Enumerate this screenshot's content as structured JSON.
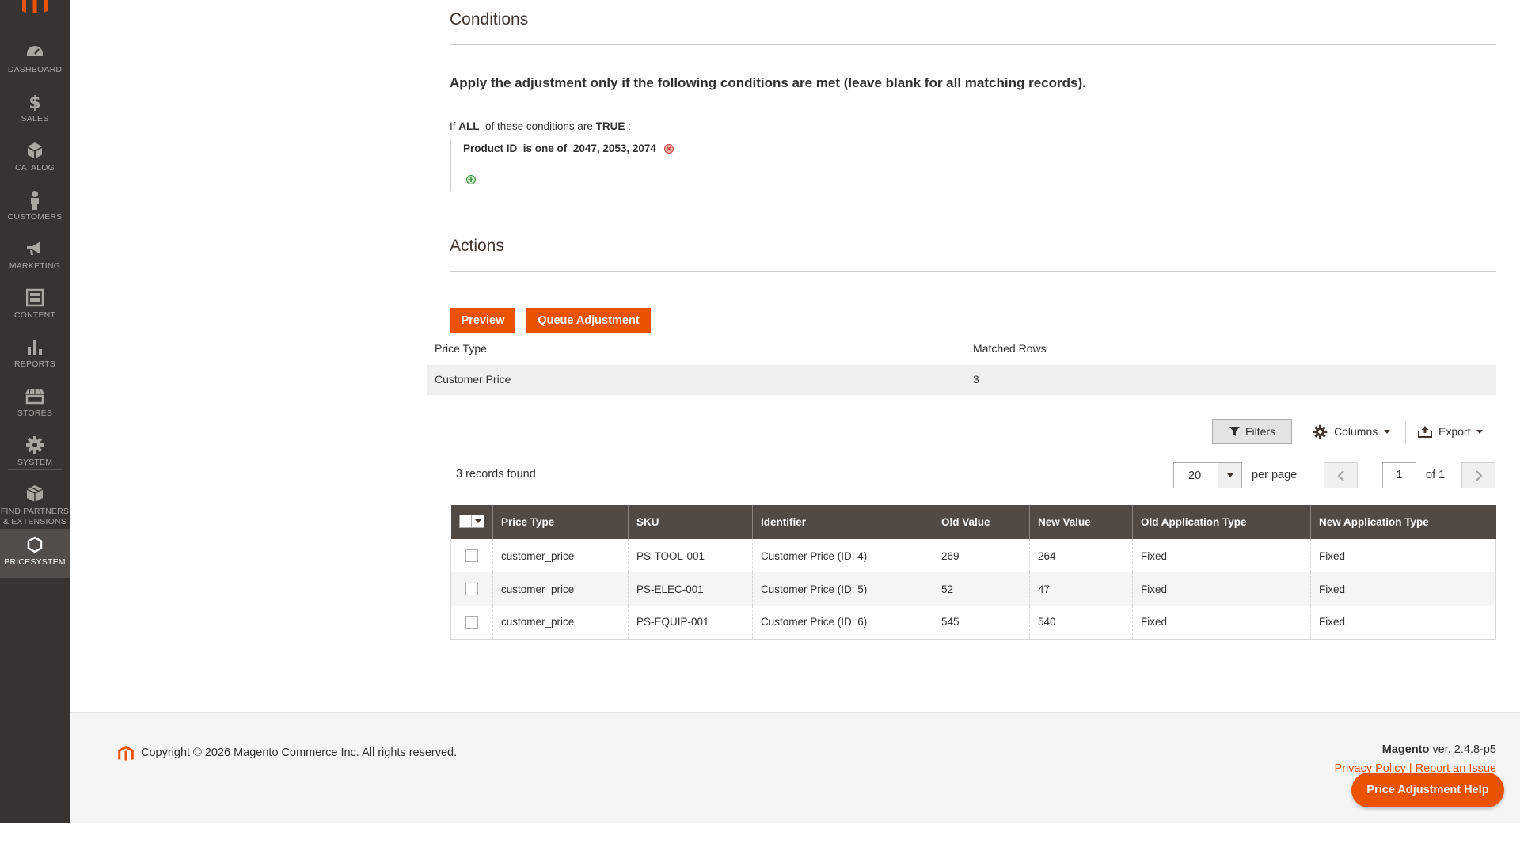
{
  "sidebar": {
    "items": [
      {
        "label": "DASHBOARD",
        "icon": "dashboard-icon"
      },
      {
        "label": "SALES",
        "icon": "dollar-icon"
      },
      {
        "label": "CATALOG",
        "icon": "cube-icon"
      },
      {
        "label": "CUSTOMERS",
        "icon": "person-icon"
      },
      {
        "label": "MARKETING",
        "icon": "megaphone-icon"
      },
      {
        "label": "CONTENT",
        "icon": "layout-icon"
      },
      {
        "label": "REPORTS",
        "icon": "bar-chart-icon"
      },
      {
        "label": "STORES",
        "icon": "storefront-icon"
      },
      {
        "label": "SYSTEM",
        "icon": "gear-icon"
      },
      {
        "label": "FIND PARTNERS & EXTENSIONS",
        "icon": "boxes-icon"
      },
      {
        "label": "PRICESYSTEM",
        "icon": "hexagon-icon"
      }
    ],
    "active": "PRICESYSTEM"
  },
  "conditions": {
    "title": "Conditions",
    "heading": "Apply the adjustment only if the following conditions are met (leave blank for all matching records).",
    "prefix": "If",
    "aggregator": "ALL",
    "middle": "of these conditions are",
    "value": "TRUE",
    "suffix": ":",
    "rule": {
      "attribute": "Product ID",
      "operator": "is one of",
      "value": "2047, 2053, 2074"
    }
  },
  "actions": {
    "title": "Actions",
    "preview_label": "Preview",
    "queue_label": "Queue Adjustment"
  },
  "summary": {
    "headers": [
      "Price Type",
      "Matched Rows"
    ],
    "rows": [
      [
        "Customer Price",
        "3"
      ]
    ]
  },
  "toolbar": {
    "filters_label": "Filters",
    "columns_label": "Columns",
    "export_label": "Export"
  },
  "pager": {
    "records": "3 records found",
    "per_page_value": "20",
    "per_page_label": "per page",
    "page": "1",
    "of_label": "of 1"
  },
  "grid": {
    "columns": [
      "Price Type",
      "SKU",
      "Identifier",
      "Old Value",
      "New Value",
      "Old Application Type",
      "New Application Type"
    ],
    "rows": [
      [
        "customer_price",
        "PS-TOOL-001",
        "Customer Price (ID: 4)",
        "269",
        "264",
        "Fixed",
        "Fixed"
      ],
      [
        "customer_price",
        "PS-ELEC-001",
        "Customer Price (ID: 5)",
        "52",
        "47",
        "Fixed",
        "Fixed"
      ],
      [
        "customer_price",
        "PS-EQUIP-001",
        "Customer Price (ID: 6)",
        "545",
        "540",
        "Fixed",
        "Fixed"
      ]
    ]
  },
  "footer": {
    "copyright": "Copyright © 2026 Magento Commerce Inc. All rights reserved.",
    "brand": "Magento",
    "version": "ver. 2.4.8-p5",
    "privacy_label": "Privacy Policy",
    "separator": "|",
    "report_label": "Report an Issue"
  },
  "help": {
    "label": "Price Adjustment Help"
  },
  "colors": {
    "accent": "#eb5202",
    "sidebar": "#373330",
    "grid_header": "#514943"
  }
}
